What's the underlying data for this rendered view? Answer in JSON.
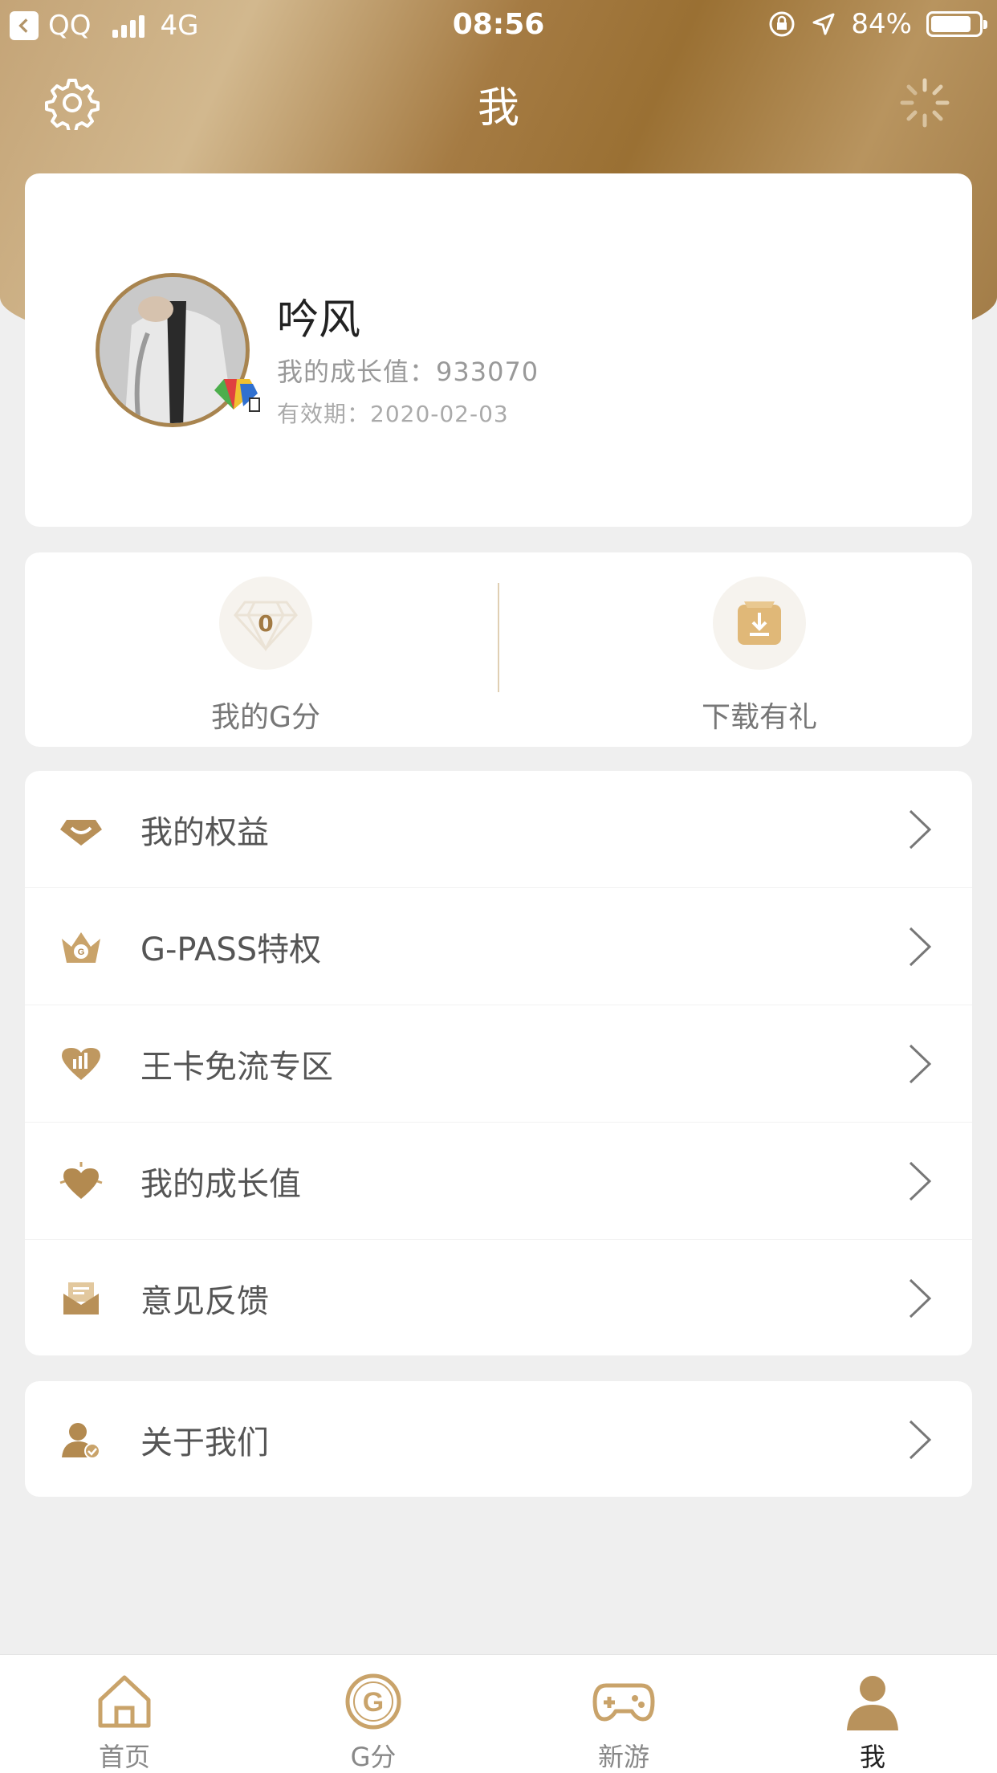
{
  "status_bar": {
    "back_app": "QQ",
    "network": "4G",
    "time": "08:56",
    "battery": "84%",
    "battery_level": 0.84
  },
  "nav": {
    "title": "我",
    "settings_icon": "gear-icon",
    "loading_icon": "spinner-icon"
  },
  "profile": {
    "username": "吟风",
    "growth": "我的成长值：933070",
    "validity": "有效期：2020-02-03"
  },
  "stats": [
    {
      "value": "0",
      "label": "我的G分",
      "icon": "diamond-icon"
    },
    {
      "label": "下载有礼",
      "icon": "download-gift-icon"
    }
  ],
  "menu": [
    {
      "label": "我的权益",
      "icon": "gem-icon"
    },
    {
      "label": "G-PASS特权",
      "icon": "crown-icon"
    },
    {
      "label": "王卡免流专区",
      "icon": "chart-heart-icon"
    },
    {
      "label": "我的成长值",
      "icon": "heart-growth-icon"
    },
    {
      "label": "意见反馈",
      "icon": "envelope-icon"
    }
  ],
  "about": {
    "label": "关于我们",
    "icon": "user-check-icon"
  },
  "tabs": [
    {
      "label": "首页",
      "icon": "home-icon"
    },
    {
      "label": "G分",
      "icon": "g-coin-icon"
    },
    {
      "label": "新游",
      "icon": "gamepad-icon"
    },
    {
      "label": "我",
      "icon": "user-icon",
      "active": true
    }
  ],
  "colors": {
    "accent_gold": "#a8844f",
    "background": "#efefef"
  }
}
